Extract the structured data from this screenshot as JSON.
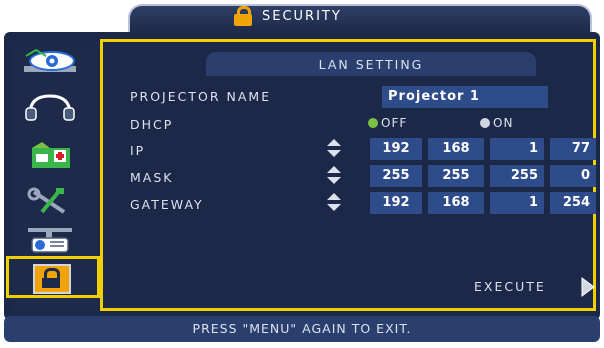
{
  "header": {
    "title": "SECURITY",
    "icon": "lock-icon"
  },
  "sidebar": {
    "items": [
      {
        "name": "picture-icon"
      },
      {
        "name": "audio-icon"
      },
      {
        "name": "setup-icon"
      },
      {
        "name": "tools-icon"
      },
      {
        "name": "projector-icon"
      },
      {
        "name": "security-icon",
        "selected": true
      }
    ]
  },
  "panel": {
    "heading": "LAN SETTING",
    "projector_name": {
      "label": "PROJECTOR NAME",
      "value": "Projector 1"
    },
    "dhcp": {
      "label": "DHCP",
      "off_label": "OFF",
      "on_label": "ON",
      "selected": "OFF"
    },
    "ip": {
      "label": "IP",
      "octets": [
        "192",
        "168",
        "1",
        "77"
      ]
    },
    "mask": {
      "label": "MASK",
      "octets": [
        "255",
        "255",
        "255",
        "0"
      ]
    },
    "gateway": {
      "label": "GATEWAY",
      "octets": [
        "192",
        "168",
        "1",
        "254"
      ]
    },
    "execute": "EXECUTE"
  },
  "footer": {
    "text": "PRESS \"MENU\" AGAIN TO EXIT."
  },
  "colors": {
    "accent": "#f0d000",
    "background": "#1c2848",
    "field": "#2f4c8a",
    "lock": "#f0a40a",
    "dhcp_off_dot": "#7ac143"
  }
}
